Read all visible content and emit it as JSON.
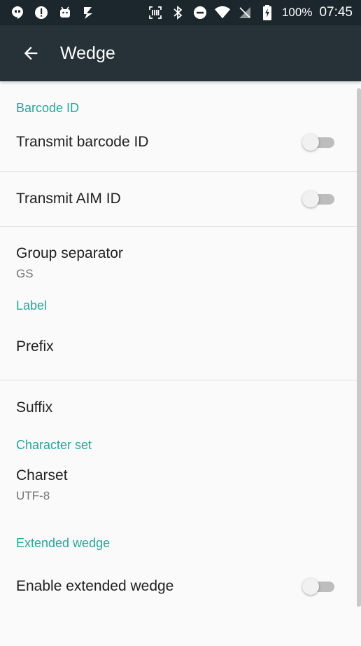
{
  "status_bar": {
    "left_icons": [
      "hangouts-icon",
      "alert-icon",
      "android-icon",
      "checkmark-icon"
    ],
    "right_icons": [
      "scanner-icon",
      "bluetooth-icon",
      "do-not-disturb-icon",
      "wifi-icon",
      "no-signal-icon",
      "battery-charging-icon"
    ],
    "battery": "100%",
    "time": "07:45"
  },
  "toolbar": {
    "title": "Wedge",
    "background": "#263238"
  },
  "accent_color": "#26a69a",
  "sections": {
    "barcode_id": {
      "header": "Barcode ID",
      "transmit_barcode_id": {
        "title": "Transmit barcode ID",
        "enabled": false
      },
      "transmit_aim_id": {
        "title": "Transmit AIM ID",
        "enabled": false
      },
      "group_separator": {
        "title": "Group separator",
        "summary": "GS"
      }
    },
    "label": {
      "header": "Label",
      "prefix": {
        "title": "Prefix"
      },
      "suffix": {
        "title": "Suffix"
      }
    },
    "character_set": {
      "header": "Character set",
      "charset": {
        "title": "Charset",
        "summary": "UTF-8"
      }
    },
    "extended_wedge": {
      "header": "Extended wedge",
      "enable_extended_wedge": {
        "title": "Enable extended wedge",
        "enabled": false
      }
    }
  }
}
